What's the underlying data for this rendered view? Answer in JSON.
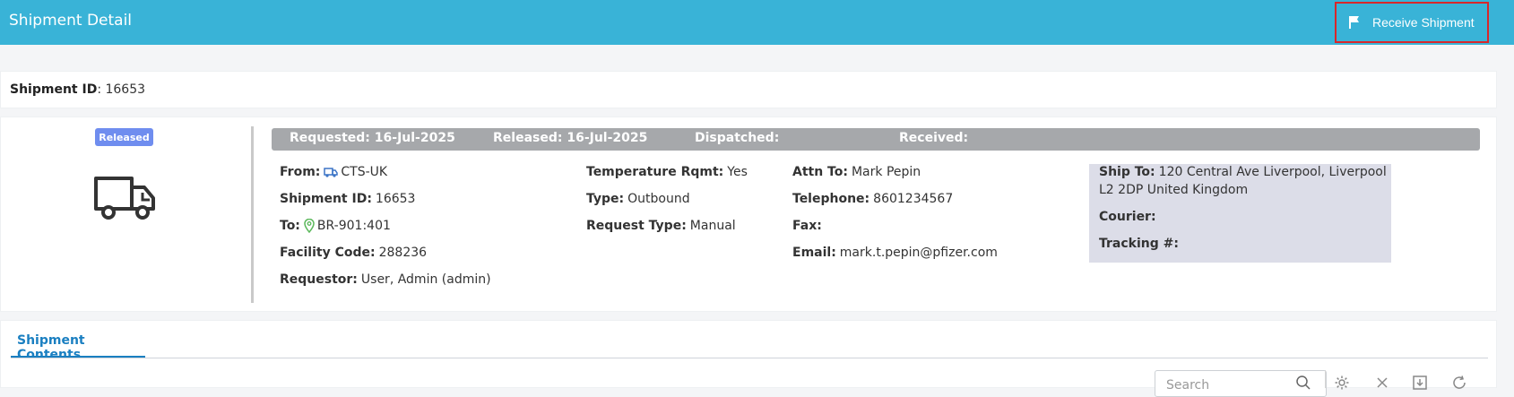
{
  "header": {
    "title": "Shipment Detail",
    "receive_label": "Receive Shipment",
    "receive_icon": "flag-icon",
    "background": "#39b3d7"
  },
  "shipment_id_line": {
    "label": "Shipment ID",
    "value": ": 16653"
  },
  "status": {
    "badge": "Released",
    "badge_color": "#6f8def",
    "truck_icon": "truck-icon",
    "requested": "Requested: 16-Jul-2025",
    "released": "Released: 16-Jul-2025",
    "dispatched": "Dispatched:",
    "received": "Received:"
  },
  "details": {
    "from": {
      "label": "From:",
      "value": "CTS-UK",
      "icon": "truck-small-icon"
    },
    "shipment_id": {
      "label": "Shipment ID:",
      "value": "16653"
    },
    "to": {
      "label": "To:",
      "value": "BR-901:401",
      "icon": "location-pin-icon"
    },
    "facility_code": {
      "label": "Facility Code:",
      "value": "288236"
    },
    "requestor": {
      "label": "Requestor:",
      "value": "User, Admin (admin)"
    },
    "temperature": {
      "label": "Temperature Rqmt:",
      "value": "Yes"
    },
    "type": {
      "label": "Type:",
      "value": "Outbound"
    },
    "request_type": {
      "label": "Request Type:",
      "value": "Manual"
    },
    "attn_to": {
      "label": "Attn To:",
      "value": "Mark Pepin"
    },
    "telephone": {
      "label": "Telephone:",
      "value": "8601234567"
    },
    "fax": {
      "label": "Fax:",
      "value": ""
    },
    "email": {
      "label": "Email:",
      "value": "mark.t.pepin@pfizer.com"
    },
    "ship_to": {
      "label": "Ship To:",
      "value_line1": "120 Central Ave Liverpool, Liverpool",
      "value_line2": "L2 2DP United Kingdom"
    },
    "courier": {
      "label": "Courier:",
      "value": ""
    },
    "tracking": {
      "label": "Tracking #:",
      "value": ""
    }
  },
  "contents": {
    "tab_label": "Shipment Contents",
    "search_placeholder": "Search",
    "tools": [
      "search-icon",
      "gear-icon",
      "close-icon",
      "export-icon",
      "refresh-icon"
    ]
  }
}
